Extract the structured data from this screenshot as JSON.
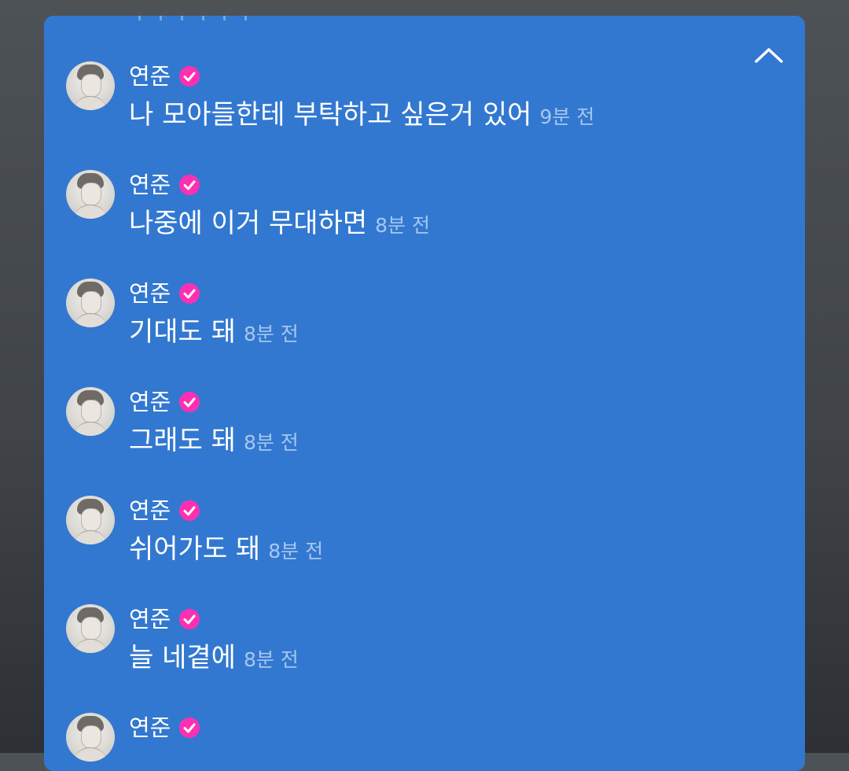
{
  "panel": {
    "collapse_icon": "chevron-up-icon"
  },
  "messages": [
    {
      "username": "연준",
      "verified": true,
      "text": "나 모아들한테 부탁하고 싶은거 있어",
      "time": "9분 전"
    },
    {
      "username": "연준",
      "verified": true,
      "text": "나중에 이거 무대하면",
      "time": "8분 전"
    },
    {
      "username": "연준",
      "verified": true,
      "text": "기대도 돼",
      "time": "8분 전"
    },
    {
      "username": "연준",
      "verified": true,
      "text": "그래도 돼",
      "time": "8분 전"
    },
    {
      "username": "연준",
      "verified": true,
      "text": "쉬어가도 돼",
      "time": "8분 전"
    },
    {
      "username": "연준",
      "verified": true,
      "text": "늘 네곁에",
      "time": "8분 전"
    },
    {
      "username": "연준",
      "verified": true,
      "text": "",
      "time": ""
    }
  ],
  "colors": {
    "panel_bg": "#3278d0",
    "badge": "#ff2fb3",
    "time_text": "#a6c7ee"
  }
}
